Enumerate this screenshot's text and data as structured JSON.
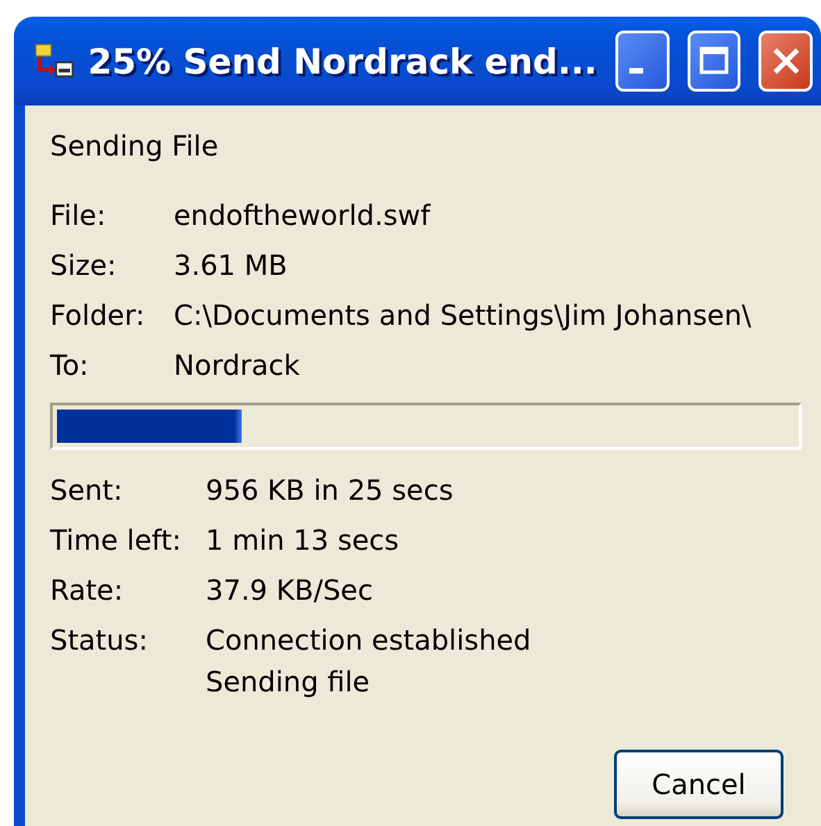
{
  "window": {
    "title": "25% Send Nordrack end...",
    "buttons": [
      {
        "kind": "minimize"
      },
      {
        "kind": "maximize"
      },
      {
        "kind": "close"
      }
    ]
  },
  "heading": "Sending File",
  "file_info": [
    {
      "label": "File:",
      "value": "endoftheworld.swf"
    },
    {
      "label": "Size:",
      "value": "3.61 MB"
    },
    {
      "label": "Folder:",
      "value": "C:\\Documents and Settings\\Jim Johansen\\"
    },
    {
      "label": "To:",
      "value": "Nordrack"
    }
  ],
  "progress": {
    "level": 0.25
  },
  "transfer_info": [
    {
      "label": "Sent:",
      "values": [
        "956 KB in 25 secs"
      ]
    },
    {
      "label": "Time left:",
      "values": [
        "1 min 13 secs"
      ]
    },
    {
      "label": "Rate:",
      "values": [
        "37.9 KB/Sec"
      ]
    },
    {
      "label": "Status:",
      "values": [
        "Connection established",
        "Sending file"
      ]
    }
  ],
  "buttons": [
    "Cancel"
  ]
}
